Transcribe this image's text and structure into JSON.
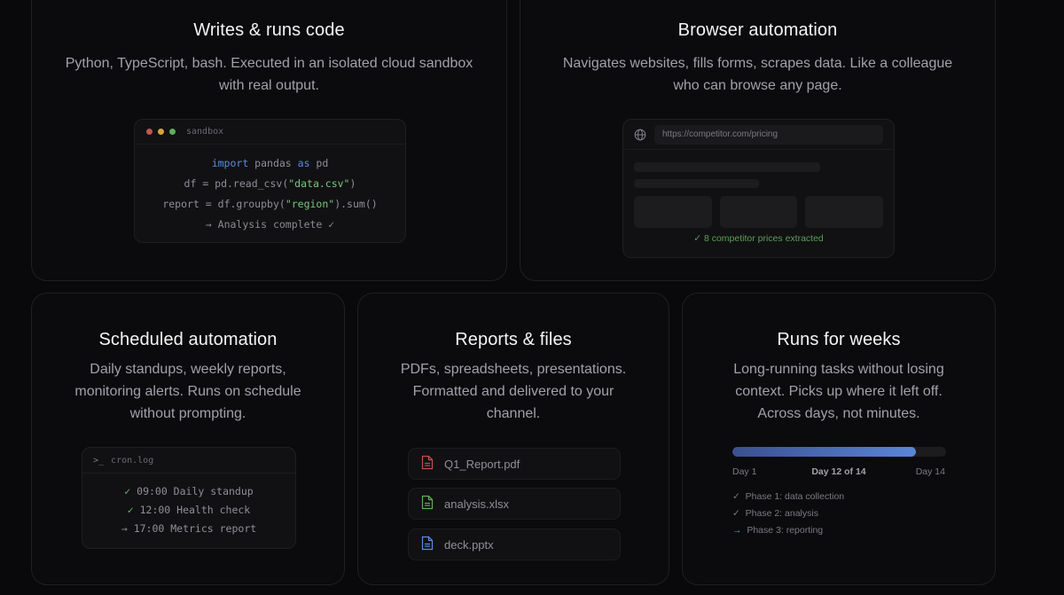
{
  "cards": {
    "code": {
      "title": "Writes & runs code",
      "desc_1": "Python, TypeScript, bash. Executed in an isolated cloud sandbox",
      "desc_2": "with real output.",
      "panel_label": "sandbox",
      "lines": {
        "l1_kw": "import",
        "l1_mid": " pandas ",
        "l1_kw2": "as",
        "l1_end": " pd",
        "l2_start": "df = pd.read_csv(",
        "l2_str": "\"data.csv\"",
        "l2_end": ")",
        "l3_start": "report = df.groupby(",
        "l3_str": "\"region\"",
        "l3_end": ").sum()",
        "l4": "→ Analysis complete ✓"
      }
    },
    "browser": {
      "title": "Browser automation",
      "desc_1": "Navigates websites, fills forms, scrapes data. Like a colleague",
      "desc_2": "who can browse any page.",
      "url": "https://competitor.com/pricing",
      "status": "✓ 8 competitor prices extracted"
    },
    "sched": {
      "title": "Scheduled automation",
      "desc_1": "Daily standups, weekly reports,",
      "desc_2": "monitoring alerts. Runs on schedule",
      "desc_3": "without prompting.",
      "panel_label": "cron.log",
      "prompt_icon": ">_",
      "entries": [
        {
          "mark": "✓",
          "text": " 09:00 Daily standup"
        },
        {
          "mark": "✓",
          "text": " 12:00 Health check"
        },
        {
          "mark": "→",
          "text": " 17:00 Metrics report"
        }
      ]
    },
    "reports": {
      "title": "Reports & files",
      "desc_1": "PDFs, spreadsheets, presentations.",
      "desc_2": "Formatted and delivered to your",
      "desc_3": "channel.",
      "files": [
        {
          "name": "Q1_Report.pdf",
          "color": "#c0504d"
        },
        {
          "name": "analysis.xlsx",
          "color": "#5fae5c"
        },
        {
          "name": "deck.pptx",
          "color": "#5b8de0"
        }
      ]
    },
    "weeks": {
      "title": "Runs for weeks",
      "desc_1": "Long-running tasks without losing",
      "desc_2": "context. Picks up where it left off.",
      "desc_3": "Across days, not minutes.",
      "progress": 0.857,
      "label_start": "Day 1",
      "label_mid": "Day 12 of 14",
      "label_end": "Day 14",
      "phases": [
        {
          "mark": "✓",
          "text": "Phase 1: data collection"
        },
        {
          "mark": "✓",
          "text": "Phase 2: analysis"
        },
        {
          "mark": "→",
          "text": "Phase 3: reporting"
        }
      ]
    }
  },
  "colors": {
    "background": "#09090b",
    "card_border": "#1f1f23",
    "accent_blue": "#5b8de0",
    "success_green": "#6fb86c",
    "dot_red": "#c5534f",
    "dot_yellow": "#d4a53a",
    "dot_green": "#5fae5c"
  }
}
